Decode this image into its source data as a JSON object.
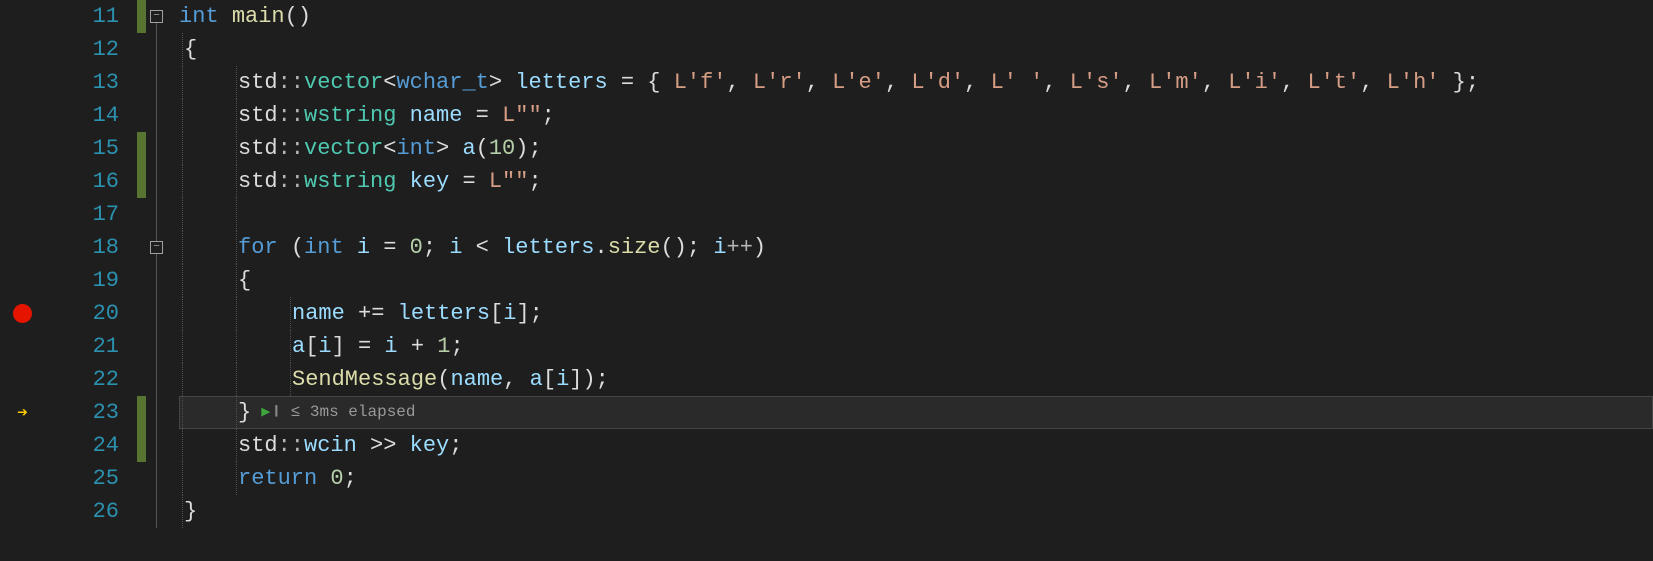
{
  "lines": {
    "11": {
      "num": "11",
      "bp": false,
      "arrow": false,
      "changed": true,
      "fold": true
    },
    "12": {
      "num": "12",
      "bp": false,
      "arrow": false,
      "changed": false,
      "fold": false
    },
    "13": {
      "num": "13",
      "bp": false,
      "arrow": false,
      "changed": false,
      "fold": false
    },
    "14": {
      "num": "14",
      "bp": false,
      "arrow": false,
      "changed": false,
      "fold": false
    },
    "15": {
      "num": "15",
      "bp": false,
      "arrow": false,
      "changed": true,
      "fold": false
    },
    "16": {
      "num": "16",
      "bp": false,
      "arrow": false,
      "changed": true,
      "fold": false
    },
    "17": {
      "num": "17",
      "bp": false,
      "arrow": false,
      "changed": false,
      "fold": false
    },
    "18": {
      "num": "18",
      "bp": false,
      "arrow": false,
      "changed": false,
      "fold": true
    },
    "19": {
      "num": "19",
      "bp": false,
      "arrow": false,
      "changed": false,
      "fold": false
    },
    "20": {
      "num": "20",
      "bp": true,
      "arrow": false,
      "changed": false,
      "fold": false
    },
    "21": {
      "num": "21",
      "bp": false,
      "arrow": false,
      "changed": false,
      "fold": false
    },
    "22": {
      "num": "22",
      "bp": false,
      "arrow": false,
      "changed": false,
      "fold": false
    },
    "23": {
      "num": "23",
      "bp": false,
      "arrow": true,
      "changed": true,
      "fold": false,
      "current": true
    },
    "24": {
      "num": "24",
      "bp": false,
      "arrow": false,
      "changed": true,
      "fold": false
    },
    "25": {
      "num": "25",
      "bp": false,
      "arrow": false,
      "changed": false,
      "fold": false
    },
    "26": {
      "num": "26",
      "bp": false,
      "arrow": false,
      "changed": false,
      "fold": false
    }
  },
  "code": {
    "kw_int": "int",
    "fn_main": "main",
    "paren_empty": "()",
    "brace_open": "{",
    "brace_close": "}",
    "std": "std",
    "dcolon": "::",
    "vector": "vector",
    "lt": "<",
    "gt": ">",
    "wchar_t": "wchar_t",
    "var_letters": "letters",
    "eq": " = ",
    "open_init": "{ ",
    "lf": "L'f'",
    "lr": "L'r'",
    "le": "L'e'",
    "ld": "L'd'",
    "lsp": "L' '",
    "ls": "L's'",
    "lm": "L'm'",
    "li": "L'i'",
    "lt2": "L't'",
    "lh": "L'h'",
    "comma": ", ",
    "close_init": " };",
    "wstring": "wstring",
    "var_name": "name",
    "l_empty": "L\"\"",
    "semi": ";",
    "int_t": "int",
    "var_a": "a",
    "p_open": "(",
    "p_close": ")",
    "ten": "10",
    "var_key": "key",
    "kw_for": "for",
    "sp": " ",
    "var_i": "i",
    "zero": "0",
    "semisp": "; ",
    "ltop": " < ",
    "dot": ".",
    "fn_size": "size",
    "inc": "++",
    "pluseq": " += ",
    "br_open": "[",
    "br_close": "]",
    "one": "1",
    "plus": " + ",
    "assign": " = ",
    "fn_send": "SendMessage",
    "wcin": "wcin",
    "extract": " >> ",
    "kw_return": "return"
  },
  "perf": {
    "label": "≤ 3ms elapsed"
  }
}
